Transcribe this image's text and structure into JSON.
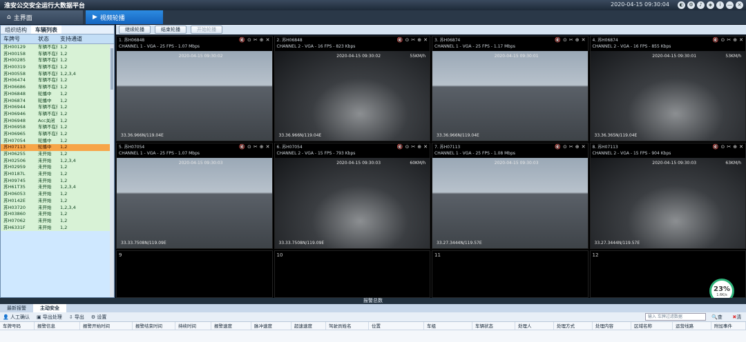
{
  "title": "淮安公交安全运行大数据平台",
  "datetime": "2020-04-15 09:30:04",
  "window_icons": [
    "◐",
    "⚙",
    "♪",
    "◈",
    "i",
    "—",
    "×"
  ],
  "tabs": [
    {
      "label": "主界面",
      "icon": "home-icon"
    },
    {
      "label": "视频轮播",
      "icon": "video-icon"
    }
  ],
  "left": {
    "tabs": [
      "组织结构",
      "车辆列表"
    ],
    "headers": [
      "车牌号",
      "状态",
      "支持通道"
    ],
    "rows": [
      [
        "苏H00129",
        "车辆不在线",
        "1,2"
      ],
      [
        "苏H00158",
        "车辆不在线",
        "1,2"
      ],
      [
        "苏H00285",
        "车辆不在线",
        "1,2"
      ],
      [
        "苏H00319",
        "车辆不在线",
        "1,2"
      ],
      [
        "苏H00558",
        "车辆不在线",
        "1,2,3,4"
      ],
      [
        "苏H06474",
        "车辆不在线",
        "1,2"
      ],
      [
        "苏H06686",
        "车辆不在线",
        "1,2"
      ],
      [
        "苏H06848",
        "轮播中",
        "1,2"
      ],
      [
        "苏H06874",
        "轮播中",
        "1,2"
      ],
      [
        "苏H06944",
        "车辆不在线",
        "1,2"
      ],
      [
        "苏H06946",
        "车辆不在线",
        "1,2"
      ],
      [
        "苏H06948",
        "Acc关闭",
        "1,2"
      ],
      [
        "苏H06958",
        "车辆不在线",
        "1,2"
      ],
      [
        "苏H06965",
        "车辆不在线",
        "1,2"
      ],
      [
        "苏H07054",
        "轮播中",
        "1,2"
      ],
      [
        "苏H07113",
        "轮播中",
        "1,2"
      ],
      [
        "苏H06255",
        "未开始",
        "1,2"
      ],
      [
        "苏H02506",
        "未开始",
        "1,2,3,4"
      ],
      [
        "苏H02959",
        "未开始",
        "1,2"
      ],
      [
        "苏H0187L",
        "未开始",
        "1,2"
      ],
      [
        "苏H09745",
        "未开始",
        "1,2"
      ],
      [
        "苏H61T35",
        "未开始",
        "1,2,3,4"
      ],
      [
        "苏H06053",
        "未开始",
        "1,2"
      ],
      [
        "苏H0142E",
        "未开始",
        "1,2"
      ],
      [
        "苏H03720",
        "未开始",
        "1,2,3,4"
      ],
      [
        "苏H03860",
        "未开始",
        "1,2"
      ],
      [
        "苏H07062",
        "未开始",
        "1,2"
      ],
      [
        "苏H6331F",
        "未开始",
        "1,2"
      ]
    ],
    "selected_index": 15
  },
  "buttons": {
    "start": "继续轮播",
    "stop": "结束轮播",
    "begin": "开始轮播"
  },
  "cells": [
    {
      "num": "1",
      "plate": "苏H06848",
      "info": "CHANNEL 1 - VGA - 25 FPS - 1.07 Mbps",
      "time": "2020-04-15 09:30:02",
      "speed": "",
      "geo": "33.36.966N/119.04E",
      "type": "road"
    },
    {
      "num": "2",
      "plate": "苏H06848",
      "info": "CHANNEL 2 - VGA - 16 FPS - 823 Kbps",
      "time": "2020-04-15 09:30:02",
      "speed": "55KM/h",
      "geo": "33.36.966N/119.04E",
      "type": "cab"
    },
    {
      "num": "3",
      "plate": "苏H06874",
      "info": "CHANNEL 1 - VGA - 25 FPS - 1.17 Mbps",
      "time": "2020-04-15 09:30:01",
      "speed": "",
      "geo": "33.36.966N/119.04E",
      "type": "road"
    },
    {
      "num": "4",
      "plate": "苏H06874",
      "info": "CHANNEL 2 - VGA - 16 FPS - 855 Kbps",
      "time": "2020-04-15 09:30:01",
      "speed": "53KM/h",
      "geo": "33.36.365N/119.04E",
      "type": "cab"
    },
    {
      "num": "5",
      "plate": "苏H07054",
      "info": "CHANNEL 1 - VGA - 25 FPS - 1.07 Mbps",
      "time": "2020-04-15 09:30:03",
      "speed": "",
      "geo": "33.33.7508N/119.09E",
      "type": "road"
    },
    {
      "num": "6",
      "plate": "苏H07054",
      "info": "CHANNEL 2 - VGA - 15 FPS - 793 Kbps",
      "time": "2020-04-15 09:30:03",
      "speed": "60KM/h",
      "geo": "33.33.7508N/119.09E",
      "type": "cab"
    },
    {
      "num": "7",
      "plate": "苏H07113",
      "info": "CHANNEL 1 - VGA - 25 FPS - 1.08 Mbps",
      "time": "2020-04-15 09:30:03",
      "speed": "",
      "geo": "33.27.3444N/119.57E",
      "type": "road"
    },
    {
      "num": "8",
      "plate": "苏H07113",
      "info": "CHANNEL 2 - VGA - 15 FPS - 904 Kbps",
      "time": "2020-04-15 09:30:03",
      "speed": "63KM/h",
      "geo": "33.27.3444N/119.57E",
      "type": "cab"
    },
    {
      "num": "9",
      "plate": "",
      "info": "",
      "time": "",
      "speed": "",
      "geo": "",
      "type": "empty"
    },
    {
      "num": "10",
      "plate": "",
      "info": "",
      "time": "",
      "speed": "",
      "geo": "",
      "type": "empty"
    },
    {
      "num": "11",
      "plate": "",
      "info": "",
      "time": "",
      "speed": "",
      "geo": "",
      "type": "empty"
    },
    {
      "num": "12",
      "plate": "",
      "info": "",
      "time": "",
      "speed": "",
      "geo": "",
      "type": "empty"
    }
  ],
  "progress": {
    "text": "23%",
    "sub": "1.6K/s",
    "fraction": 0.23
  },
  "alarm_title": "报警总数",
  "bottom_tabs": [
    "最新报警",
    "主动安全"
  ],
  "tools": {
    "manual": "人工确认",
    "export_batch": "导出处理",
    "export": "导出",
    "settings": "设置",
    "filter_placeholder": "输入 车牌过滤数据",
    "search": "查找",
    "clear": "清除"
  },
  "columns": [
    "车牌号码",
    "报警信息",
    "报警开始时间",
    "报警结束时间",
    "持续时间",
    "报警速度",
    "脉冲速度",
    "超速速度",
    "驾驶员姓名",
    "位置",
    "车组",
    "车辆状态",
    "处理人",
    "处理方式",
    "处理内容",
    "区域名称",
    "运营线路",
    "附加事件"
  ],
  "colors": {
    "accent": "#1565c0",
    "selected_row": "#f7a548",
    "online_row": "#d8f2d6",
    "ring": "#2fb37a"
  }
}
